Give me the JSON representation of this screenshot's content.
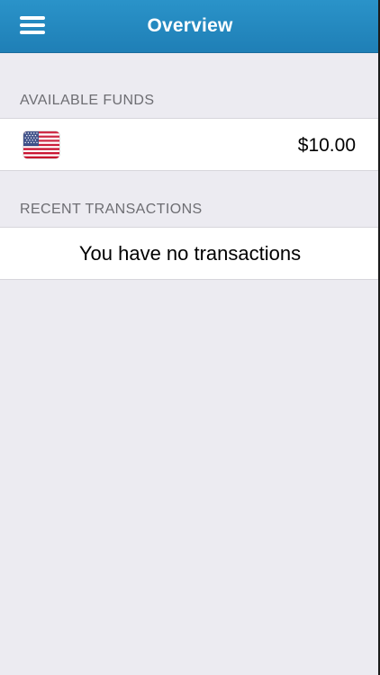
{
  "header": {
    "title": "Overview",
    "menu_icon": "hamburger-menu-icon"
  },
  "funds": {
    "section_label": "AVAILABLE FUNDS",
    "currency_flag": "us-flag-icon",
    "amount": "$10.00"
  },
  "transactions": {
    "section_label": "RECENT TRANSACTIONS",
    "empty_message": "You have no transactions"
  },
  "colors": {
    "navbar": "#2a93c9",
    "background": "#ecebf1",
    "section_text": "#6d6d72"
  }
}
